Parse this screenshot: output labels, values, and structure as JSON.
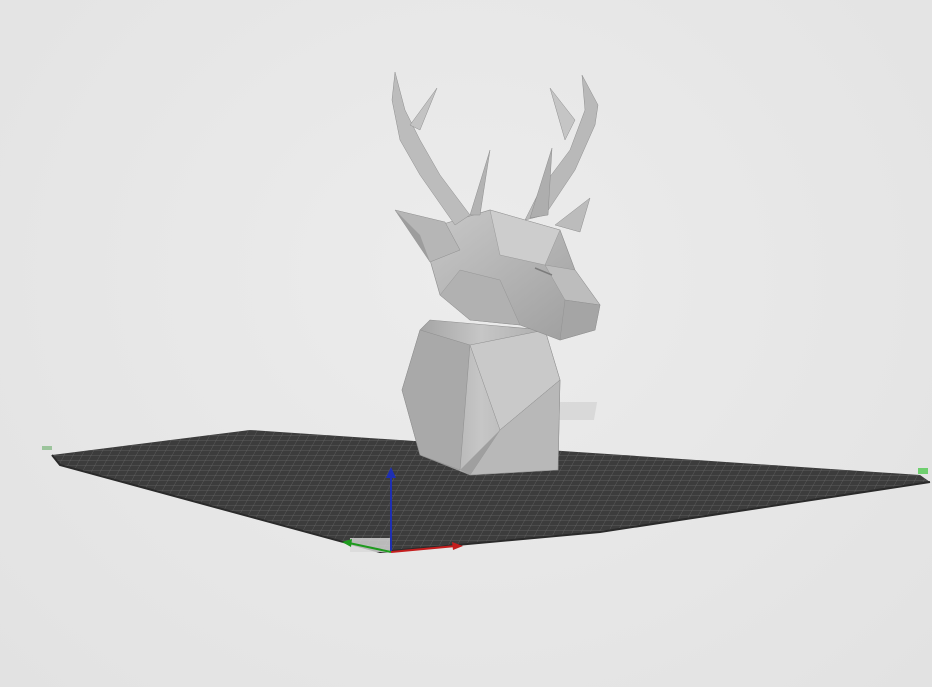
{
  "viewport": {
    "background_color": "#e7e7e7",
    "bed_color": "#3a3a3a",
    "bed_grid_color": "#6b6b6b",
    "model_color": "#b4b4b4",
    "model_name": "",
    "axes": {
      "x_color": "#c41e1e",
      "y_color": "#1e9a1e",
      "z_color": "#1e2fb4"
    }
  },
  "icons": {
    "bed": "build-plate-grid",
    "model": "low-poly-deer-head-model",
    "axis_gizmo": "xyz-axis-gizmo"
  }
}
